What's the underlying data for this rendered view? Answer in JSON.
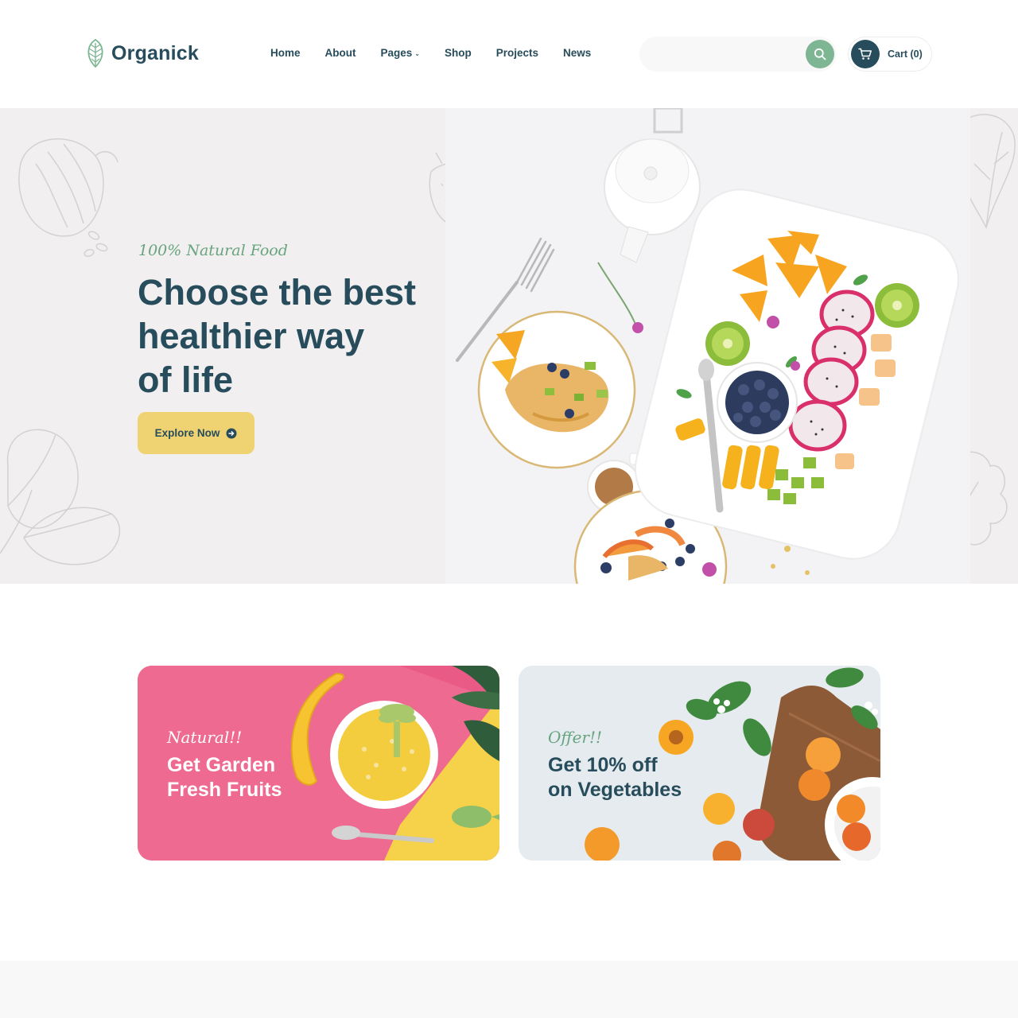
{
  "brand": {
    "name": "Organick"
  },
  "nav": {
    "items": [
      {
        "label": "Home"
      },
      {
        "label": "About"
      },
      {
        "label": "Pages",
        "has_dropdown": true
      },
      {
        "label": "Shop"
      },
      {
        "label": "Projects"
      },
      {
        "label": "News"
      }
    ]
  },
  "search": {
    "value": "",
    "placeholder": ""
  },
  "cart": {
    "label": "Cart (0)"
  },
  "hero": {
    "tag": "100% Natural Food",
    "title_lines": [
      "Choose the best",
      "healthier way",
      "of life"
    ],
    "button_label": "Explore Now"
  },
  "banners": [
    {
      "tag": "Natural!!",
      "title_lines": [
        "Get Garden",
        "Fresh Fruits"
      ]
    },
    {
      "tag": "Offer!!",
      "title_lines": [
        "Get 10% off",
        "on Vegetables"
      ]
    }
  ],
  "colors": {
    "primary_dark": "#274c5b",
    "accent_green": "#7eb693",
    "accent_yellow": "#efd372",
    "accent_pink": "#ee6a91",
    "hero_bg": "#f1efef"
  }
}
